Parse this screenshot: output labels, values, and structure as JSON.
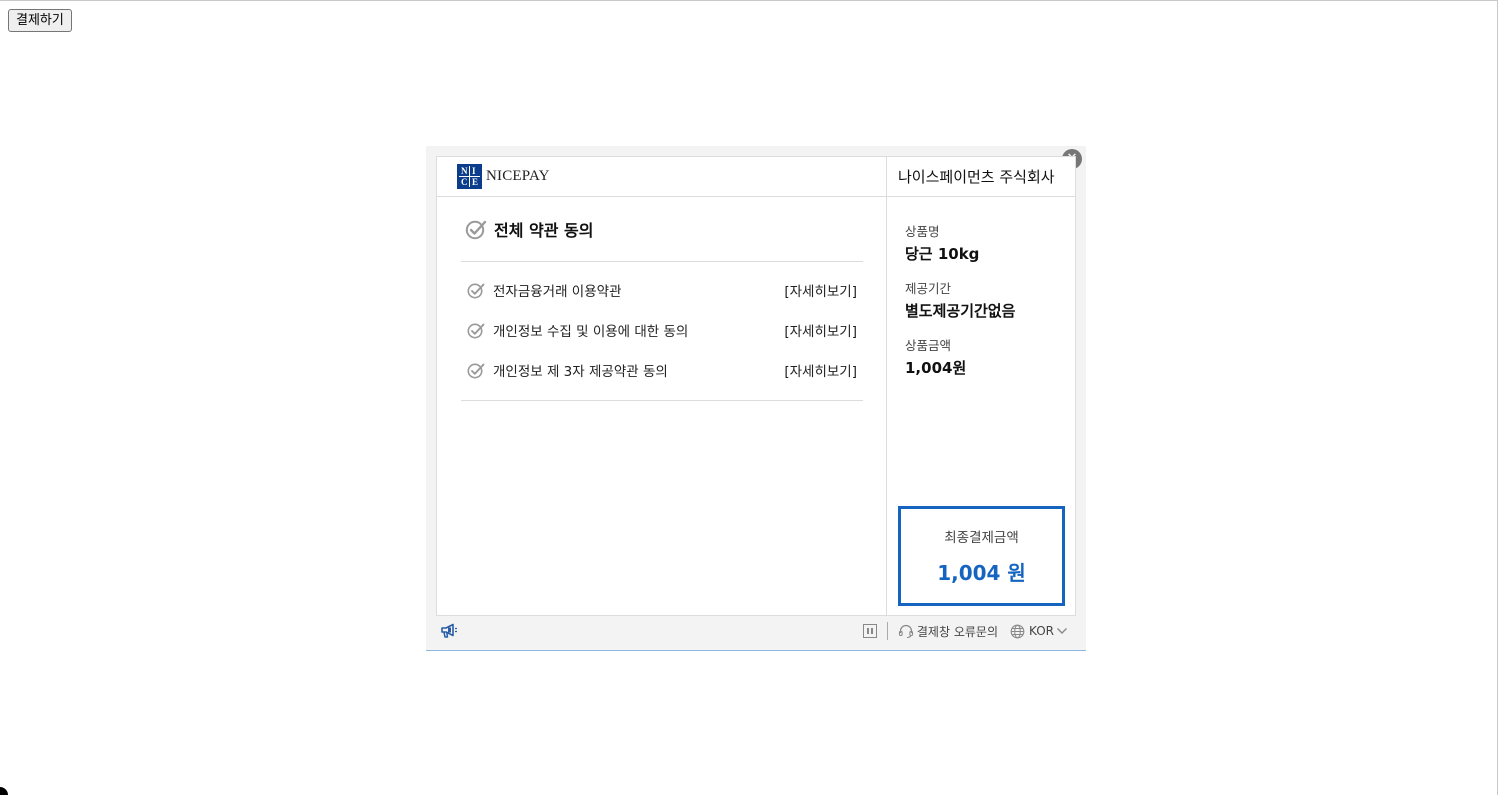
{
  "page": {
    "pay_button_label": "결제하기"
  },
  "modal": {
    "close_icon": "close-icon",
    "brand": {
      "logo_letters": [
        "N",
        "I",
        "C",
        "E"
      ],
      "logo_text": "NICEPAY"
    },
    "merchant_name": "나이스페이먼츠 주식회사",
    "terms": {
      "all_agree_label": "전체 약관 동의",
      "items": [
        {
          "label": "전자금융거래 이용약관",
          "detail": "[자세히보기]"
        },
        {
          "label": "개인정보 수집 및 이용에 대한 동의",
          "detail": "[자세히보기]"
        },
        {
          "label": "개인정보 제 3자 제공약관 동의",
          "detail": "[자세히보기]"
        }
      ]
    },
    "product": {
      "name_label": "상품명",
      "name_value": "당근 10kg",
      "period_label": "제공기간",
      "period_value": "별도제공기간없음",
      "price_label": "상품금액",
      "price_value": "1,004원"
    },
    "total": {
      "label": "최종결제금액",
      "value": "1,004 원"
    },
    "footer": {
      "help_label": "결제창 오류문의",
      "language": "KOR"
    },
    "colors": {
      "accent": "#1565c0",
      "check": "#9a9a9a",
      "brand_dark": "#0b3d8c"
    }
  }
}
